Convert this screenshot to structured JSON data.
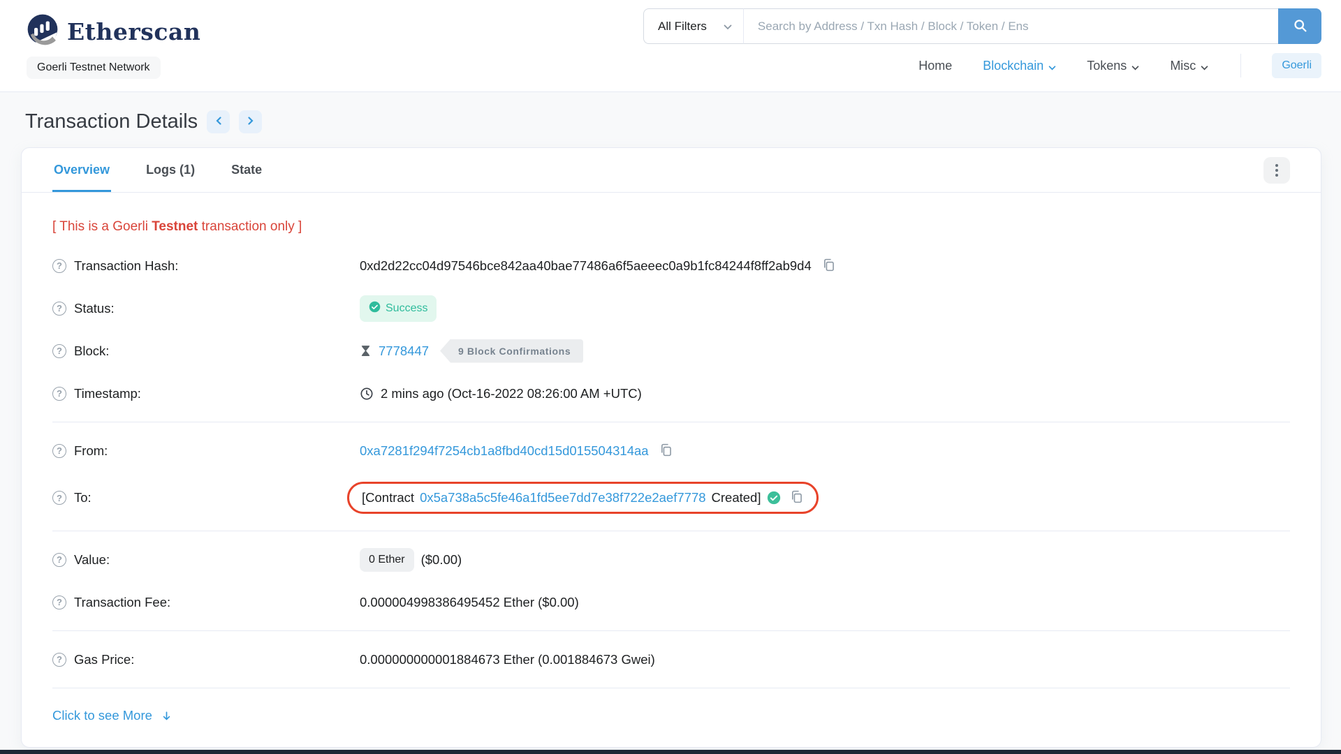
{
  "colors": {
    "accent_blue": "#3498db",
    "brand_navy": "#21325b",
    "success_green": "#2fbc9c",
    "notice_red": "#d9453a",
    "annotation_red": "#e8432a",
    "search_button_blue": "#5499d6"
  },
  "header": {
    "brand": "Etherscan",
    "network_badge": "Goerli Testnet Network",
    "search": {
      "filter_label": "All Filters",
      "placeholder": "Search by Address / Txn Hash / Block / Token / Ens"
    },
    "nav": [
      {
        "label": "Home"
      },
      {
        "label": "Blockchain"
      },
      {
        "label": "Tokens"
      },
      {
        "label": "Misc"
      }
    ],
    "network_button": "Goerli"
  },
  "page": {
    "title": "Transaction Details"
  },
  "tabs": [
    {
      "label": "Overview"
    },
    {
      "label": "Logs (1)"
    },
    {
      "label": "State"
    }
  ],
  "notice": {
    "prefix": "[ This is a Goerli ",
    "bold": "Testnet",
    "suffix": " transaction only ]"
  },
  "overview": {
    "transaction_hash": {
      "label": "Transaction Hash:",
      "value": "0xd2d22cc04d97546bce842aa40bae77486a6f5aeeec0a9b1fc84244f8ff2ab9d4"
    },
    "status": {
      "label": "Status:",
      "value": "Success"
    },
    "block": {
      "label": "Block:",
      "number": "7778447",
      "confirmations": "9 Block Confirmations"
    },
    "timestamp": {
      "label": "Timestamp:",
      "value": "2 mins ago (Oct-16-2022 08:26:00 AM +UTC)"
    },
    "from": {
      "label": "From:",
      "address": "0xa7281f294f7254cb1a8fbd40cd15d015504314aa"
    },
    "to": {
      "label": "To:",
      "prefix": "[Contract",
      "address": "0x5a738a5c5fe46a1fd5ee7dd7e38f722e2aef7778",
      "suffix": "Created]"
    },
    "value": {
      "label": "Value:",
      "amount": "0 Ether",
      "usd": "($0.00)"
    },
    "transaction_fee": {
      "label": "Transaction Fee:",
      "value": "0.000004998386495452 Ether ($0.00)"
    },
    "gas_price": {
      "label": "Gas Price:",
      "value": "0.000000000001884673 Ether (0.001884673 Gwei)"
    },
    "more_link": "Click to see More"
  },
  "icons": {
    "help_glyph": "?"
  }
}
